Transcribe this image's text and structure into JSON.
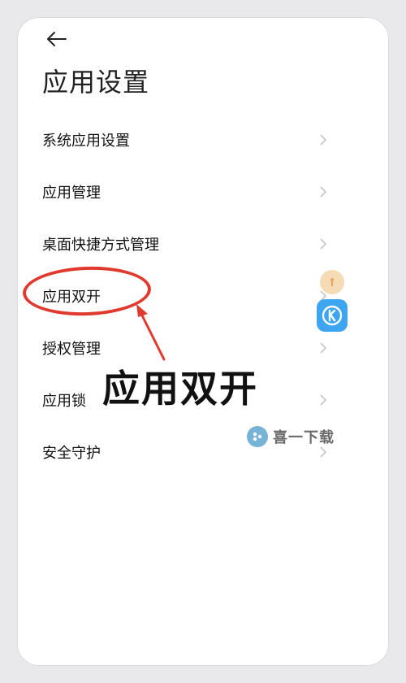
{
  "header": {
    "back_icon": "back-arrow-icon",
    "title": "应用设置"
  },
  "menu": {
    "items": [
      {
        "label": "系统应用设置",
        "icon": "chevron-right-icon"
      },
      {
        "label": "应用管理",
        "icon": "chevron-right-icon"
      },
      {
        "label": "桌面快捷方式管理",
        "icon": "chevron-right-icon"
      },
      {
        "label": "应用双开",
        "icon": "chevron-right-icon"
      },
      {
        "label": "授权管理",
        "icon": "chevron-right-icon"
      },
      {
        "label": "应用锁",
        "icon": "chevron-right-icon"
      },
      {
        "label": "安全守护",
        "icon": "chevron-right-icon"
      }
    ]
  },
  "annotation": {
    "callout_text": "应用双开",
    "highlight_color": "#e03a2e"
  },
  "watermark": {
    "text": "喜一下载",
    "logo_icon": "xiyi-logo-icon"
  },
  "colors": {
    "page_background": "#e9e9eb",
    "card_background": "#ffffff",
    "chevron": "#c4c4c4",
    "side_app_blue": "#3ea5f1"
  }
}
